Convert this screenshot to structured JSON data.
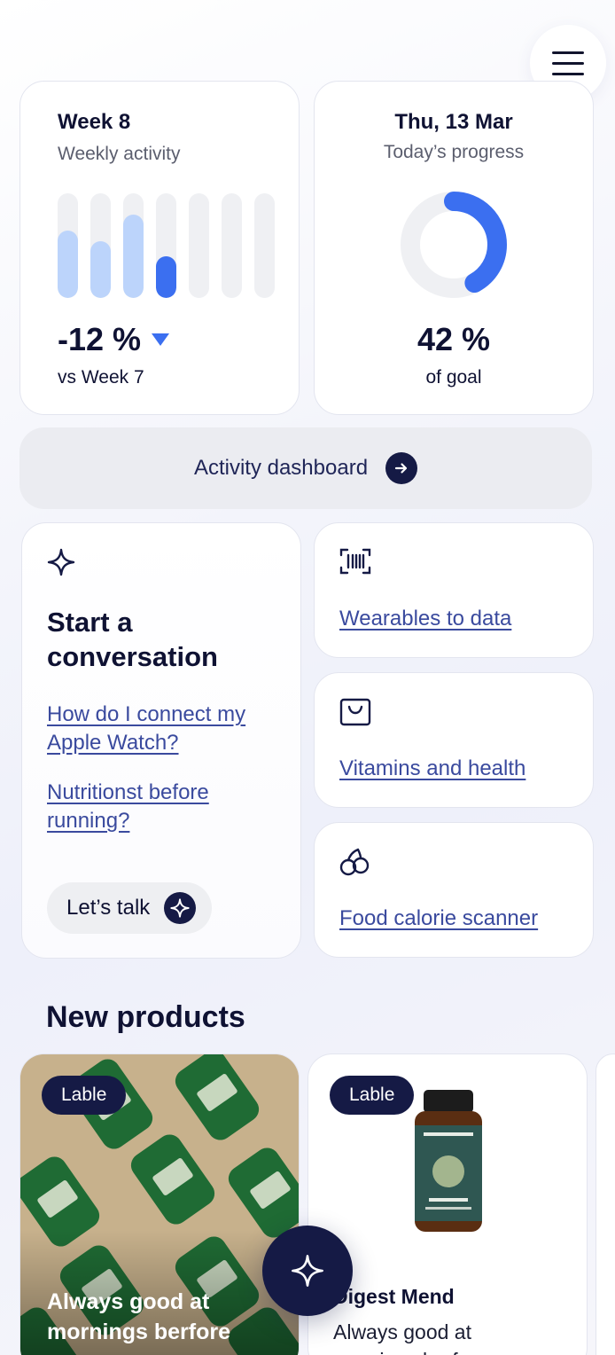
{
  "header": {
    "menu_icon": "hamburger-icon"
  },
  "week_card": {
    "title": "Week 8",
    "subtitle": "Weekly activity",
    "bars": [
      {
        "level": 0.64,
        "color": "#bcd4fb"
      },
      {
        "level": 0.54,
        "color": "#bcd4fb"
      },
      {
        "level": 0.8,
        "color": "#bcd4fb"
      },
      {
        "level": 0.4,
        "color": "#3b6ff0"
      },
      {
        "level": 0,
        "color": "#eff0f3"
      },
      {
        "level": 0,
        "color": "#eff0f3"
      },
      {
        "level": 0,
        "color": "#eff0f3"
      }
    ],
    "change": "-12 %",
    "trend_icon": "triangle-down-icon",
    "compare": "vs Week 7"
  },
  "today_card": {
    "title": "Thu, 13 Mar",
    "subtitle": "Today’s progress",
    "progress": 0.42,
    "accent": "#3b6ff0",
    "value": "42 %",
    "goal_label": "of goal"
  },
  "dashboard_button": {
    "label": "Activity dashboard",
    "icon": "arrow-right-icon"
  },
  "conversation": {
    "icon": "sparkle-icon",
    "title_line1": "Start a",
    "title_line2": "conversation",
    "suggestion1_line1": "How do I connect my",
    "suggestion1_line2": "Apple Watch?",
    "suggestion2_line1": "Nutritionst before",
    "suggestion2_line2": "running?",
    "talk_label": "Let’s talk"
  },
  "features": [
    {
      "icon": "barcode-scan-icon",
      "label": "Wearables to data"
    },
    {
      "icon": "shopping-bag-icon",
      "label": "Vitamins and health"
    },
    {
      "icon": "cherries-icon",
      "label": "Food calorie scanner"
    }
  ],
  "products": {
    "section_title": "New products",
    "items": [
      {
        "badge": "Lable",
        "overlay_line1": "Always good at",
        "overlay_line2": "mornings berfore"
      },
      {
        "badge": "Lable",
        "name": "Digest Mend",
        "desc_line1": "Always good at",
        "desc_line2": "mornings berfore"
      }
    ]
  },
  "fab": {
    "icon": "sparkle-icon"
  }
}
